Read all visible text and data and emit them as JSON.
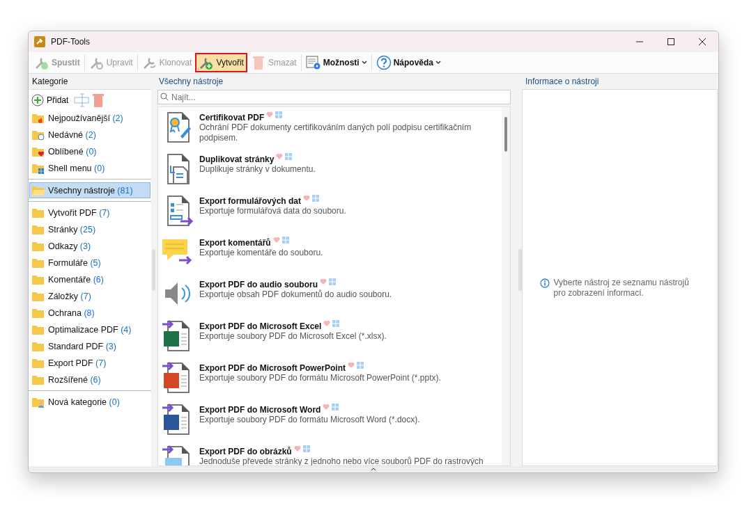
{
  "window": {
    "title": "PDF-Tools"
  },
  "toolbar": [
    {
      "label": "Spustit",
      "kind": "run",
      "disabled": true,
      "highlighted": false,
      "dropdown": false,
      "bold": true
    },
    {
      "label": "Upravit",
      "kind": "edit",
      "disabled": true,
      "highlighted": false,
      "dropdown": false,
      "bold": false
    },
    {
      "label": "Klonovat",
      "kind": "clone",
      "disabled": true,
      "highlighted": false,
      "dropdown": false,
      "bold": false
    },
    {
      "label": "Vytvořit",
      "kind": "create",
      "disabled": false,
      "highlighted": true,
      "dropdown": false,
      "bold": false
    },
    {
      "label": "Smazat",
      "kind": "delete",
      "disabled": true,
      "highlighted": false,
      "dropdown": false,
      "bold": false
    },
    {
      "label": "Možnosti",
      "kind": "options",
      "disabled": false,
      "highlighted": false,
      "dropdown": true,
      "bold": true
    },
    {
      "label": "Nápověda",
      "kind": "help",
      "disabled": false,
      "highlighted": false,
      "dropdown": true,
      "bold": true
    }
  ],
  "categories": {
    "title": "Kategorie",
    "add_label": "Přidat",
    "groups": [
      [
        {
          "name": "Nejpoužívanější",
          "count": "(2)",
          "kind": "fire",
          "selected": false
        },
        {
          "name": "Nedávné",
          "count": "(2)",
          "kind": "clock",
          "selected": false
        },
        {
          "name": "Oblíbené",
          "count": "(0)",
          "kind": "heart",
          "selected": false
        },
        {
          "name": "Shell menu",
          "count": "(0)",
          "kind": "windows",
          "selected": false
        }
      ],
      [
        {
          "name": "Všechny nástroje",
          "count": "(81)",
          "kind": "open",
          "selected": true
        }
      ],
      [
        {
          "name": "Vytvořit PDF",
          "count": "(7)",
          "kind": "plain",
          "selected": false
        },
        {
          "name": "Stránky",
          "count": "(25)",
          "kind": "plain",
          "selected": false
        },
        {
          "name": "Odkazy",
          "count": "(3)",
          "kind": "plain",
          "selected": false
        },
        {
          "name": "Formuláře",
          "count": "(5)",
          "kind": "plain",
          "selected": false
        },
        {
          "name": "Komentáře",
          "count": "(6)",
          "kind": "plain",
          "selected": false
        },
        {
          "name": "Záložky",
          "count": "(7)",
          "kind": "plain",
          "selected": false
        },
        {
          "name": "Ochrana",
          "count": "(8)",
          "kind": "plain",
          "selected": false
        },
        {
          "name": "Optimalizace PDF",
          "count": "(4)",
          "kind": "plain",
          "selected": false
        },
        {
          "name": "Standard PDF",
          "count": "(3)",
          "kind": "plain",
          "selected": false
        },
        {
          "name": "Export PDF",
          "count": "(7)",
          "kind": "plain",
          "selected": false
        },
        {
          "name": "Rozšířené",
          "count": "(6)",
          "kind": "plain",
          "selected": false
        }
      ],
      [
        {
          "name": "Nová kategorie",
          "count": "(0)",
          "kind": "user",
          "selected": false
        }
      ]
    ]
  },
  "tools": {
    "title": "Všechny nástroje",
    "search": {
      "placeholder": "Najít..."
    },
    "items": [
      {
        "name": "Certifikovat PDF",
        "description": "Ochrání PDF dokumenty certifikováním daných polí podpisu certifikačním podpisem.",
        "kind": "certify"
      },
      {
        "name": "Duplikovat stránky",
        "description": "Duplikuje stránky v dokumentu.",
        "kind": "duplicate"
      },
      {
        "name": "Export formulářových dat",
        "description": "Exportuje formulářová data do souboru.",
        "kind": "form"
      },
      {
        "name": "Export komentářů",
        "description": "Exportuje komentáře do souboru.",
        "kind": "comment"
      },
      {
        "name": "Export PDF do audio souboru",
        "description": "Exportuje obsah PDF dokumentů do audio souboru.",
        "kind": "audio"
      },
      {
        "name": "Export PDF do Microsoft Excel",
        "description": "Exportuje soubory PDF do Microsoft Excel (*.xlsx).",
        "kind": "excel"
      },
      {
        "name": "Export PDF do Microsoft PowerPoint",
        "description": "Exportuje soubory PDF do formátu Microsoft PowerPoint (*.pptx).",
        "kind": "ppt"
      },
      {
        "name": "Export PDF do Microsoft Word",
        "description": "Exportuje soubory PDF do formátu Microsoft Word (*.docx).",
        "kind": "word"
      },
      {
        "name": "Export PDF do obrázků",
        "description": "Jednoduše převede stránky z jednoho nebo více souborů PDF do rastrových",
        "kind": "image"
      }
    ]
  },
  "info": {
    "title": "Informace o nástroji",
    "message": "Vyberte nástroj ze seznamu nástrojů pro zobrazení informací."
  }
}
